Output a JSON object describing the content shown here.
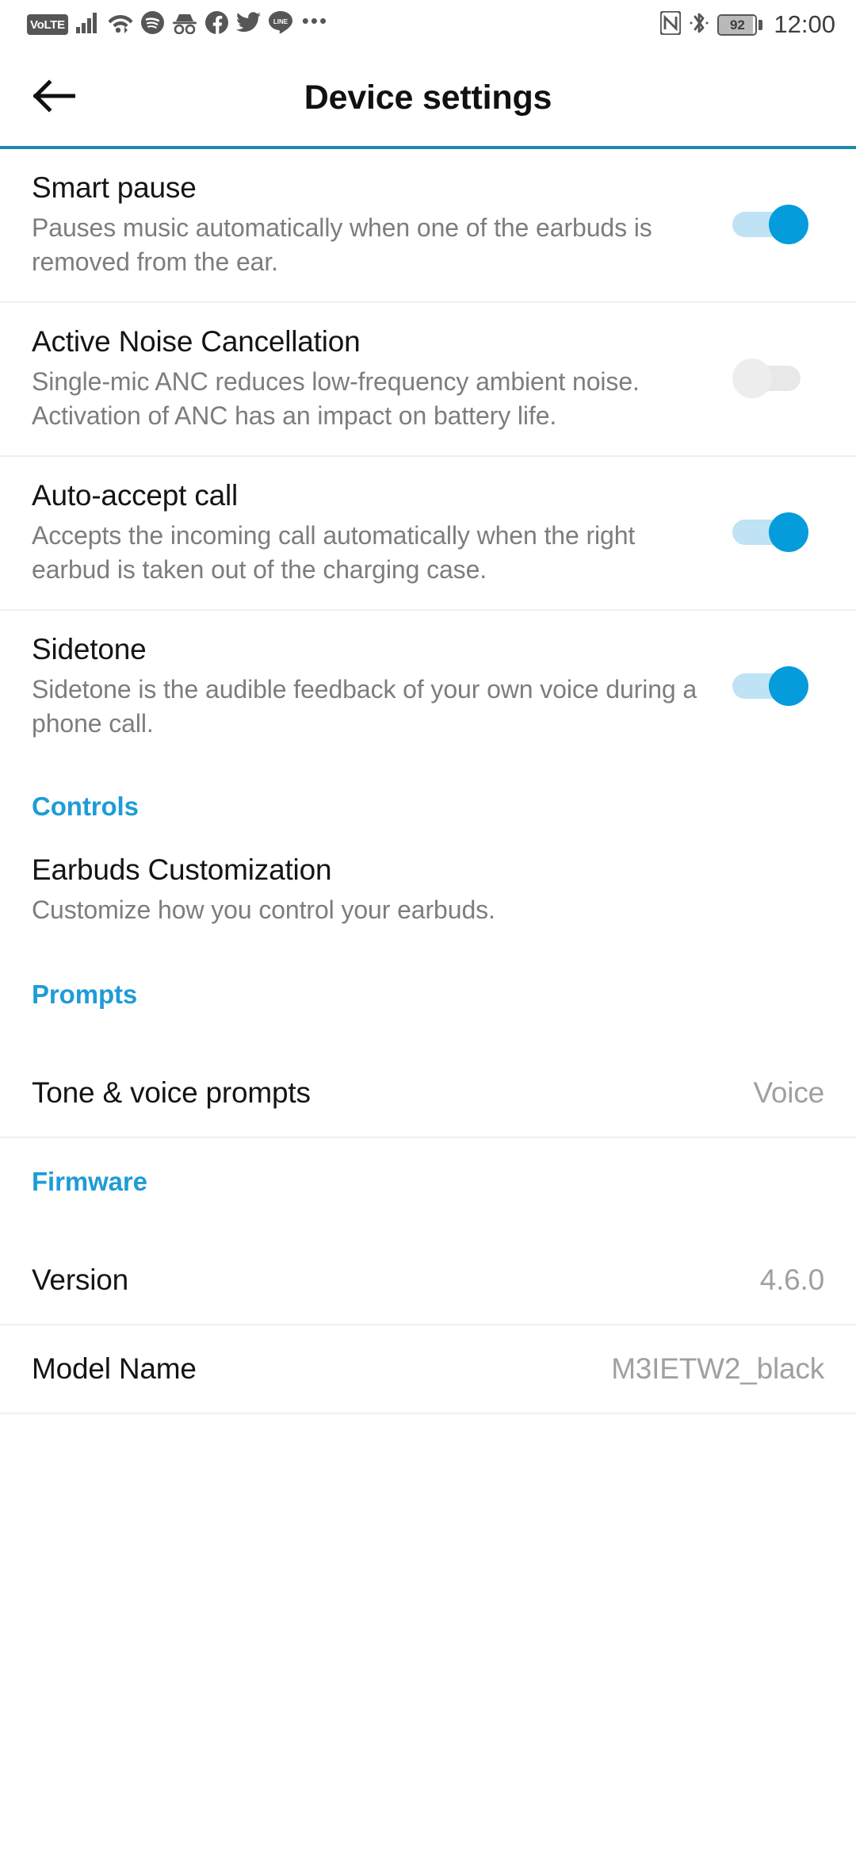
{
  "status_bar": {
    "volte_label": "VoLTE",
    "icons": [
      "volte-icon",
      "signal-bars-icon",
      "wifi-icon",
      "spotify-icon",
      "incognito-icon",
      "facebook-icon",
      "twitter-icon",
      "line-icon",
      "more-notifications-icon"
    ],
    "overflow": "•••",
    "nfc_icon": "nfc-icon",
    "bluetooth_icon": "bluetooth-icon",
    "battery_percent": "92",
    "battery_level": 92,
    "time": "12:00"
  },
  "header": {
    "back_icon": "back-arrow-icon",
    "title": "Device settings",
    "accent_color": "#1e88ad"
  },
  "settings": [
    {
      "name": "smart-pause",
      "title": "Smart pause",
      "description": "Pauses music automatically when one of the earbuds is removed from the ear.",
      "toggle": "on"
    },
    {
      "name": "active-noise-cancellation",
      "title": "Active Noise Cancellation",
      "description": "Single-mic ANC reduces low-frequency ambient noise. Activation of ANC has an impact on battery life.",
      "toggle": "off"
    },
    {
      "name": "auto-accept-call",
      "title": "Auto-accept call",
      "description": "Accepts the incoming call automatically when the right earbud is taken out of the charging case.",
      "toggle": "on"
    },
    {
      "name": "sidetone",
      "title": "Sidetone",
      "description": "Sidetone is the audible feedback of your own voice during a phone call.",
      "toggle": "on"
    }
  ],
  "sections": {
    "controls": {
      "header": "Controls",
      "item": {
        "title": "Earbuds Customization",
        "description": "Customize how you control your earbuds."
      }
    },
    "prompts": {
      "header": "Prompts",
      "item": {
        "label": "Tone & voice prompts",
        "value": "Voice"
      }
    },
    "firmware": {
      "header": "Firmware",
      "version": {
        "label": "Version",
        "value": "4.6.0"
      },
      "model": {
        "label": "Model Name",
        "value": "M3IETW2_black"
      }
    }
  },
  "colors": {
    "accent_blue": "#1e9cd7",
    "toggle_on": "#049cdb",
    "toggle_on_track": "#bfe2f4",
    "toggle_off": "#ededed",
    "secondary_text": "#7d7d7d"
  }
}
